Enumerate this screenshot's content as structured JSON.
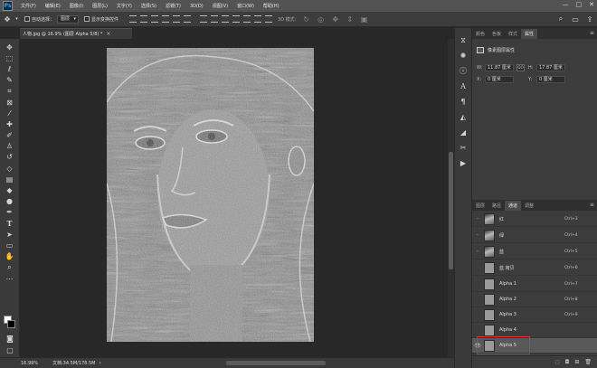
{
  "menu": {
    "logo": "Ps",
    "items": [
      "文件(F)",
      "编辑(E)",
      "图像(I)",
      "图层(L)",
      "文字(Y)",
      "选择(S)",
      "滤镜(T)",
      "3D(D)",
      "视图(V)",
      "窗口(W)",
      "帮助(H)"
    ],
    "window_controls": [
      "—",
      "□",
      "✕"
    ]
  },
  "options": {
    "auto_select_label": "自动选择：",
    "auto_select_value": "图层",
    "show_transform_label": "显示变换控件",
    "mode_label": "3D 模式："
  },
  "document_tab": {
    "title": "人物.jpg @ 16.9% (图层 Alpha 5/8) *",
    "close": "×"
  },
  "status": {
    "zoom": "16.99%",
    "doc_info": "文档:34.5M/178.5M",
    "arrow": "›"
  },
  "top_panel": {
    "tabs": [
      "颜色",
      "色板",
      "样式",
      "属性"
    ],
    "active_tab": 3,
    "header": "像素图层属性",
    "w_label": "W:",
    "w_value": "11.87 厘米",
    "h_label": "H:",
    "h_value": "17.87 厘米",
    "link_label": "GO",
    "x_label": "X:",
    "x_value": "0 厘米",
    "y_label": "Y:",
    "y_value": "0 厘米"
  },
  "channels_panel": {
    "tabs": [
      "图层",
      "路径",
      "通道",
      "调整"
    ],
    "active_tab": 2,
    "rows": [
      {
        "name": "红",
        "shortcut": "Ctrl+3",
        "visible": true,
        "thumb": "photo"
      },
      {
        "name": "绿",
        "shortcut": "Ctrl+4",
        "visible": true,
        "thumb": "photo"
      },
      {
        "name": "蓝",
        "shortcut": "Ctrl+5",
        "visible": true,
        "thumb": "photo"
      },
      {
        "name": "蓝 拷贝",
        "shortcut": "Ctrl+6",
        "visible": false,
        "thumb": "gray"
      },
      {
        "name": "Alpha 1",
        "shortcut": "Ctrl+7",
        "visible": false,
        "thumb": "gray"
      },
      {
        "name": "Alpha 2",
        "shortcut": "Ctrl+8",
        "visible": false,
        "thumb": "gray"
      },
      {
        "name": "Alpha 3",
        "shortcut": "Ctrl+9",
        "visible": false,
        "thumb": "gray"
      },
      {
        "name": "Alpha 4",
        "shortcut": "",
        "visible": false,
        "thumb": "gray"
      },
      {
        "name": "Alpha 5",
        "shortcut": "",
        "visible": true,
        "thumb": "gray",
        "selected": true
      }
    ],
    "footer_icons": [
      "dotted-circle-icon",
      "mask-icon",
      "new-channel-icon",
      "trash-icon"
    ]
  },
  "colors": {
    "highlight": "#e02f2f",
    "ps_blue": "#31a8ff"
  }
}
